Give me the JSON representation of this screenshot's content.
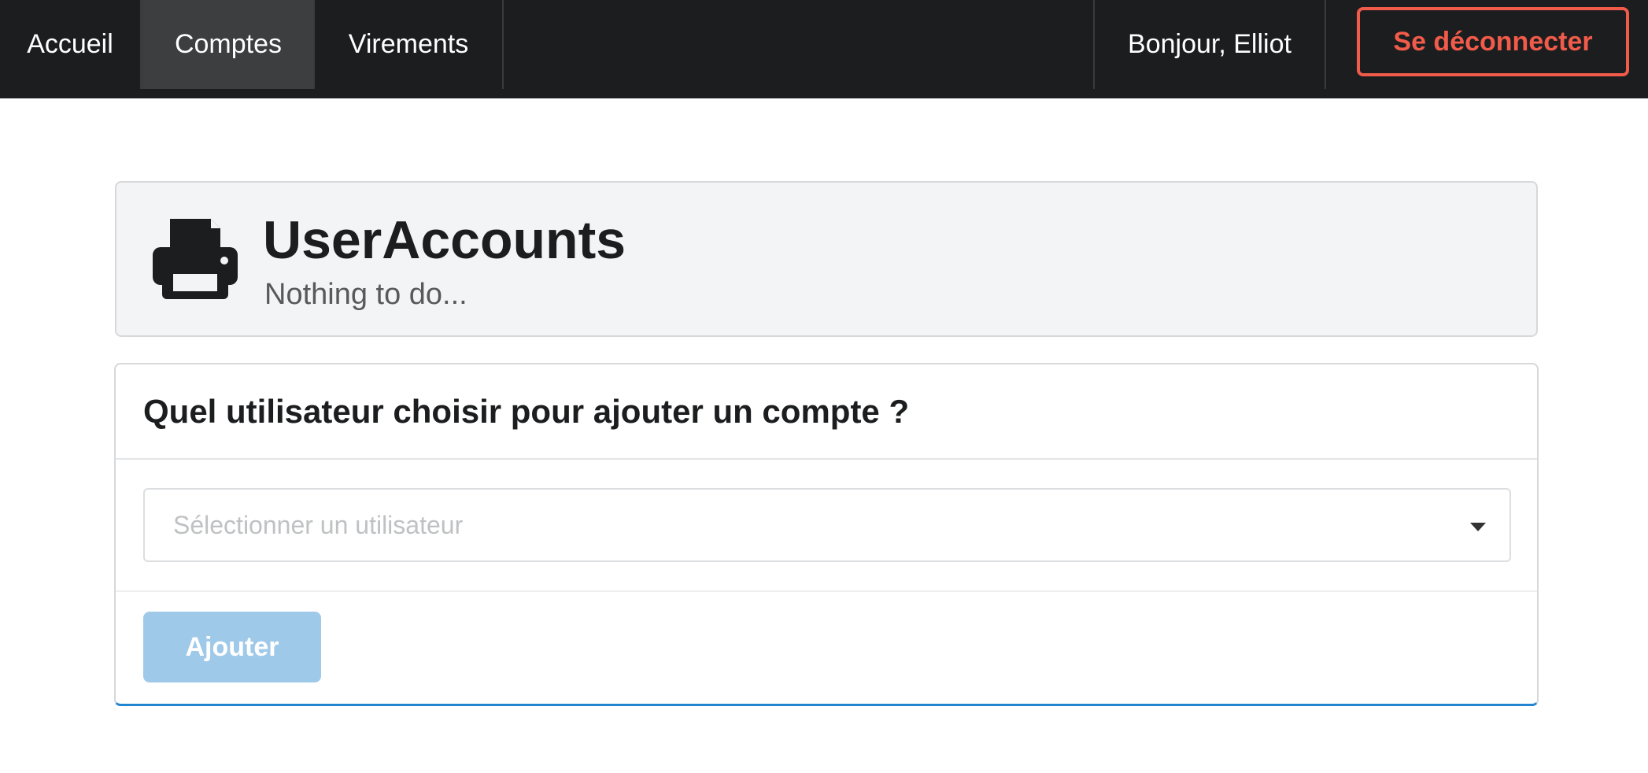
{
  "nav": {
    "items": [
      {
        "label": "Accueil",
        "active": false
      },
      {
        "label": "Comptes",
        "active": true
      },
      {
        "label": "Virements",
        "active": false
      }
    ],
    "greeting": "Bonjour, Elliot",
    "logout_label": "Se déconnecter"
  },
  "header": {
    "icon": "printer-icon",
    "title": "UserAccounts",
    "subtitle": "Nothing to do..."
  },
  "form": {
    "heading": "Quel utilisateur choisir pour ajouter un compte ?",
    "select_placeholder": "Sélectionner un utilisateur",
    "submit_label": "Ajouter"
  },
  "colors": {
    "nav_background": "#1c1d1f",
    "nav_active": "#3d3e40",
    "logout_accent": "#f15b4a",
    "header_panel": "#f3f4f5",
    "primary_button_disabled": "#9fc9e9",
    "card_accent": "#2185d0"
  }
}
